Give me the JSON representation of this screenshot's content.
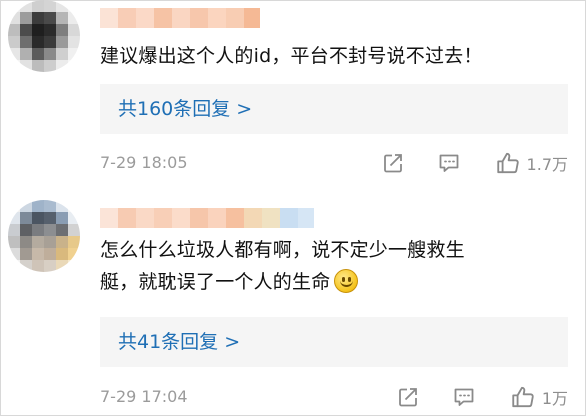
{
  "colors": {
    "link": "#1f6fb5",
    "reply_box_bg": "#f5f5f5",
    "meta_text": "#9b9b9b",
    "icon": "#8a8a8a",
    "username_blur": "#f6c3a0"
  },
  "comments": [
    {
      "text": "建议爆出这个人的id，平台不封号说不过去！",
      "replies_label": "共160条回复 >",
      "time": "7-29 18:05",
      "like_count": "1.7万",
      "icons": [
        "share-icon",
        "comment-icon",
        "like-icon"
      ]
    },
    {
      "text_line1": "怎么什么垃圾人都有啊，说不定少一艘救生",
      "text_line2": "艇，就耽误了一个人的生命",
      "emoji": "smile-emoji",
      "replies_label": "共41条回复 >",
      "time": "7-29 17:04",
      "like_count": "1万",
      "icons": [
        "share-icon",
        "comment-icon",
        "like-icon"
      ]
    }
  ]
}
